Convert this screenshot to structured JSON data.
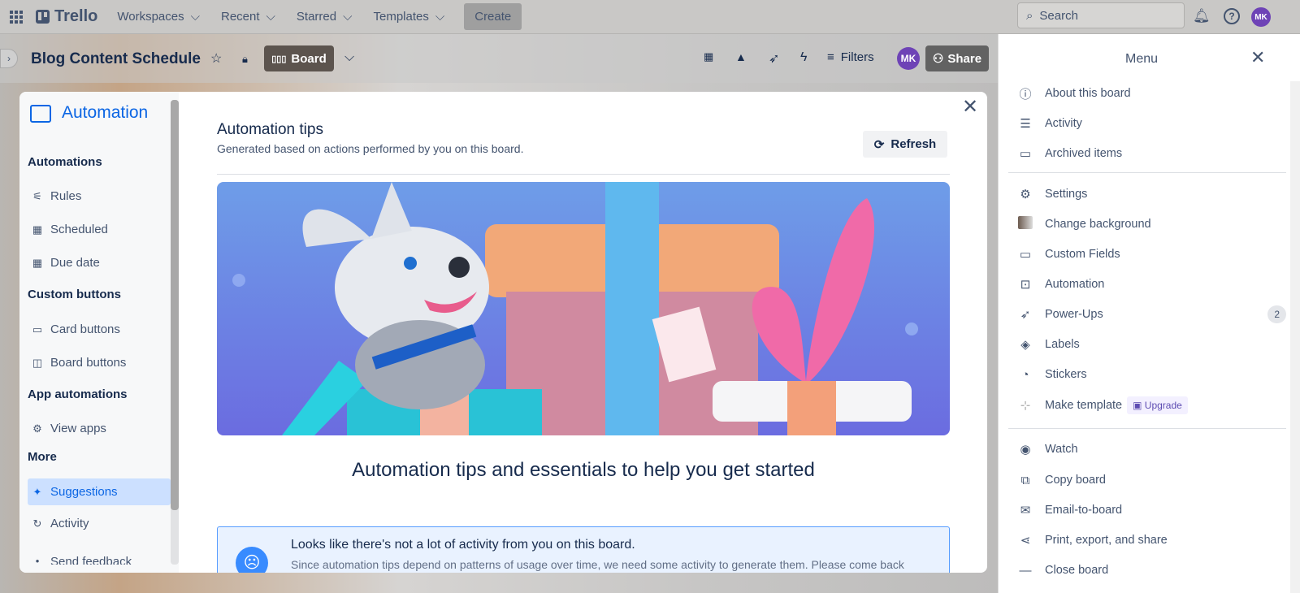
{
  "topnav": {
    "logo": "Trello",
    "items": [
      "Workspaces",
      "Recent",
      "Starred",
      "Templates"
    ],
    "create": "Create",
    "search_placeholder": "Search",
    "avatar": "MK"
  },
  "board": {
    "title": "Blog Content Schedule",
    "view": "Board",
    "filters": "Filters",
    "share": "Share",
    "avatar": "MK"
  },
  "automation": {
    "title": "Automation",
    "sections": [
      {
        "label": "Automations",
        "items": [
          "Rules",
          "Scheduled",
          "Due date"
        ]
      },
      {
        "label": "Custom buttons",
        "items": [
          "Card buttons",
          "Board buttons"
        ]
      },
      {
        "label": "App automations",
        "items": [
          "View apps"
        ]
      },
      {
        "label": "More",
        "items": [
          "Suggestions",
          "Activity",
          "Send feedback"
        ]
      }
    ],
    "active_item": "Suggestions",
    "tips_title": "Automation tips",
    "tips_subtitle": "Generated based on actions performed by you on this board.",
    "refresh": "Refresh",
    "headline": "Automation tips and essentials to help you get started",
    "info_title": "Looks like there's not a lot of activity from you on this board.",
    "info_text": "Since automation tips depend on patterns of usage over time, we need some activity to generate them. Please come back"
  },
  "menu": {
    "title": "Menu",
    "items": [
      "About this board",
      "Activity",
      "Archived items",
      "Settings",
      "Change background",
      "Custom Fields",
      "Automation",
      "Power-Ups",
      "Labels",
      "Stickers",
      "Make template",
      "Watch",
      "Copy board",
      "Email-to-board",
      "Print, export, and share",
      "Close board"
    ],
    "powerups_count": "2",
    "upgrade": "Upgrade"
  },
  "colors": {
    "accent": "#0c66e4",
    "avatar": "#6e43b6",
    "active_bg": "#cce0ff"
  }
}
